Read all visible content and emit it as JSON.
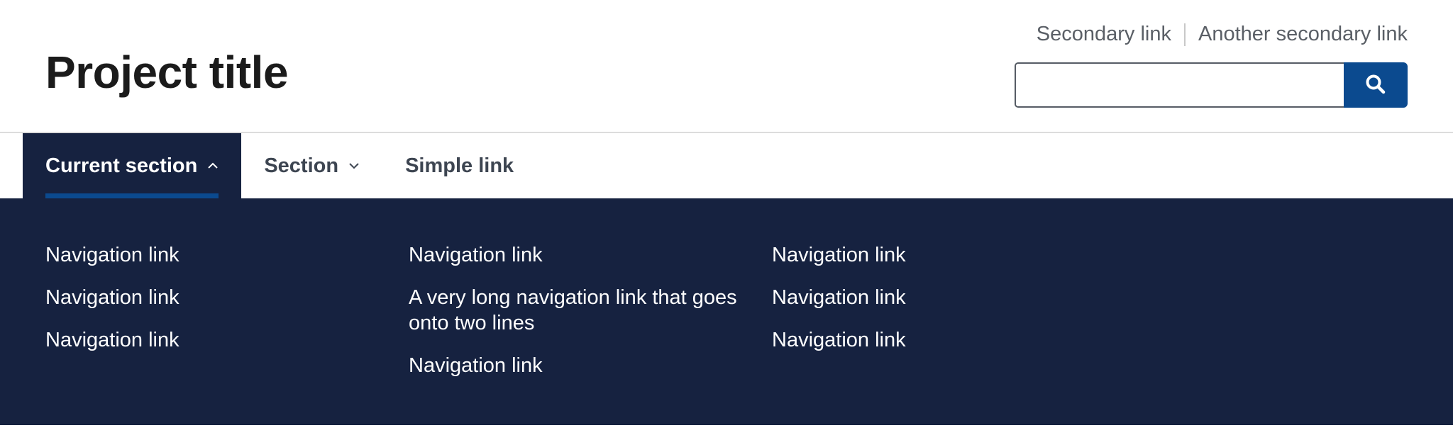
{
  "header": {
    "title": "Project title",
    "secondary_links": [
      "Secondary link",
      "Another secondary link"
    ],
    "search": {
      "value": "",
      "button_icon": "search-icon"
    }
  },
  "nav": {
    "items": [
      {
        "label": "Current section",
        "icon": "chevron-up-icon",
        "state": "current-open"
      },
      {
        "label": "Section",
        "icon": "chevron-down-icon",
        "state": "closed"
      },
      {
        "label": "Simple link"
      }
    ]
  },
  "megamenu": {
    "columns": [
      [
        "Navigation link",
        "Navigation link",
        "Navigation link"
      ],
      [
        "Navigation link",
        "A very long navigation link that goes onto two lines",
        "Navigation link"
      ],
      [
        "Navigation link",
        "Navigation link",
        "Navigation link"
      ]
    ]
  },
  "colors": {
    "primary": "#0b4a8f",
    "dark_navy": "#162240",
    "text": "#1b1b1b",
    "muted": "#5a5f66"
  }
}
